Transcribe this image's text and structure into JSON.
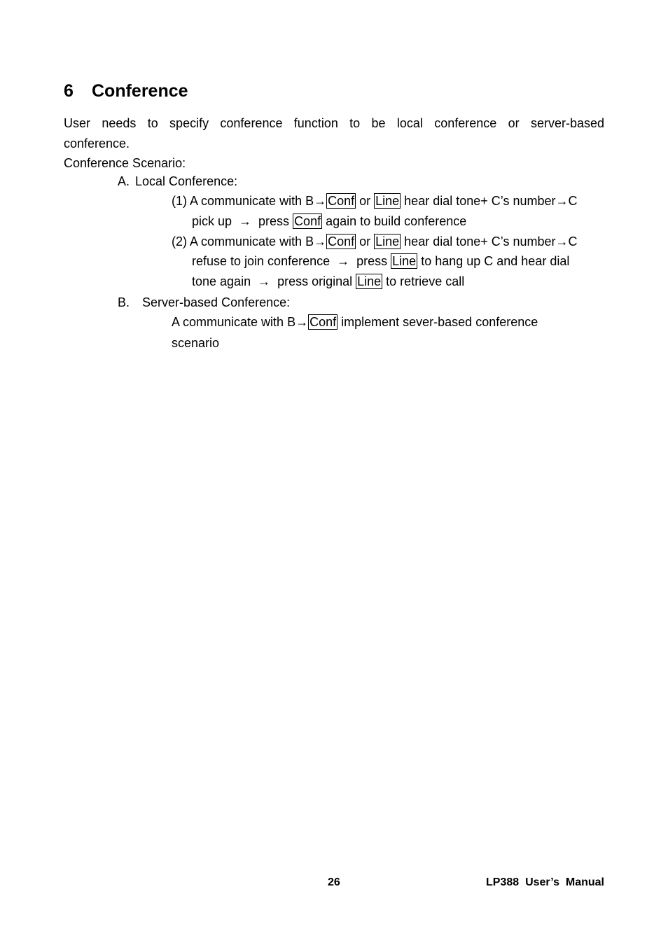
{
  "section": {
    "number": "6",
    "title": "Conference"
  },
  "intro": {
    "line1": "User needs to specify conference function to be local conference or server-based",
    "line2": "conference.",
    "scenario_label": "Conference Scenario:"
  },
  "local": {
    "marker": "A.",
    "title": "Local Conference:",
    "step1": {
      "num": "(1)",
      "l1_a": "A communicate with B→",
      "key1": "Conf",
      "l1_b": " or ",
      "key2": "Line",
      "l1_c": " hear dial tone+ C’s number→C",
      "l2_a": "pick up  →  press ",
      "key3": "Conf",
      "l2_b": " again to build conference"
    },
    "step2": {
      "num": "(2)",
      "l1_a": "A communicate with B→",
      "key1": "Conf",
      "l1_b": " or ",
      "key2": "Line",
      "l1_c": " hear dial tone+ C’s number→C",
      "l2_a": "refuse to join conference  →  press ",
      "key3": "Line",
      "l2_b": " to hang up C and hear dial",
      "l3_a": "tone again  →  press original ",
      "key4": "Line",
      "l3_b": " to retrieve call"
    }
  },
  "server": {
    "marker": "B.",
    "title": "Server-based Conference:",
    "l1_a": "A communicate with B→",
    "key1": "Conf",
    "l1_b": " implement sever-based conference",
    "l2": "scenario"
  },
  "footer": {
    "page_number": "26",
    "manual_title": "LP388  User’s  Manual"
  }
}
